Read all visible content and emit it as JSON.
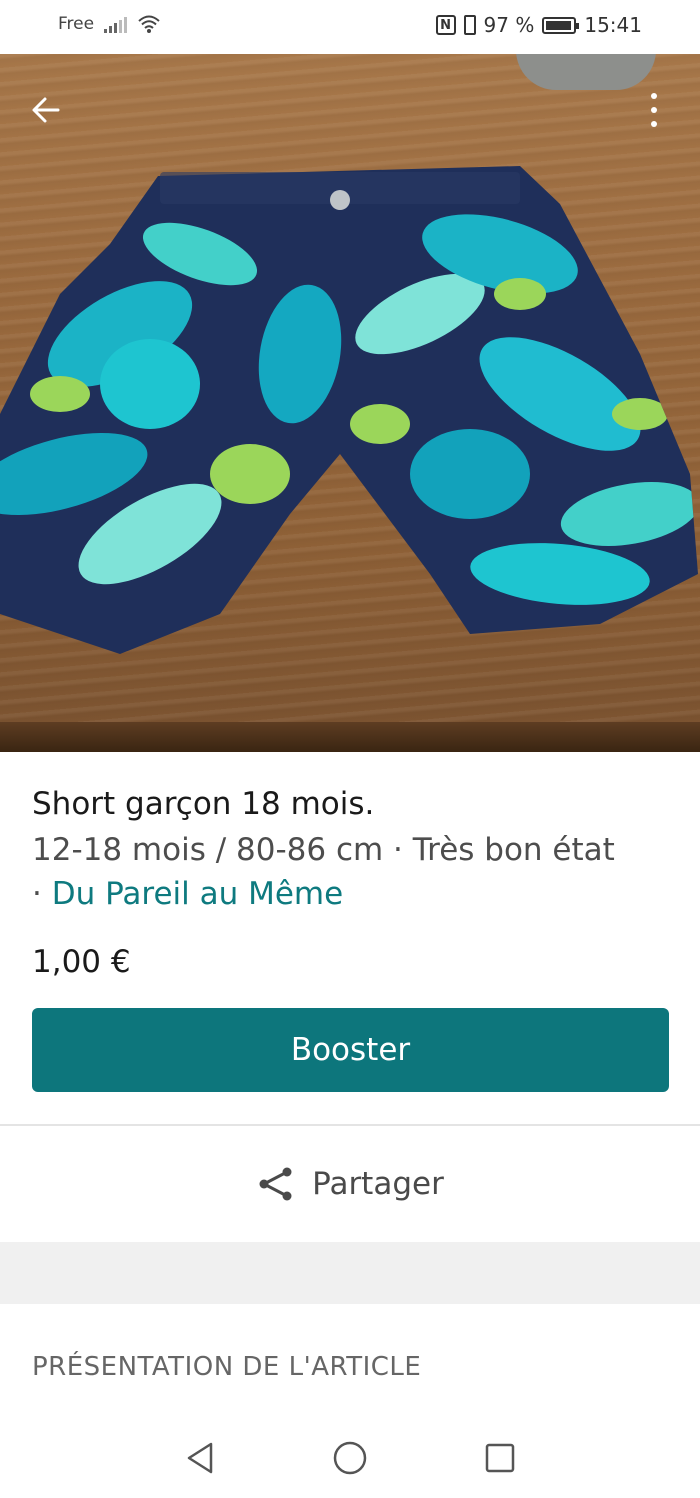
{
  "status_bar": {
    "carrier": "Free",
    "battery": "97 %",
    "time": "15:41",
    "nfc": "N"
  },
  "hero": {
    "icons": {
      "back": "arrow-left-icon",
      "more": "more-vertical-icon"
    }
  },
  "listing": {
    "title": "Short garçon 18 mois.",
    "details": "12-18 mois / 80-86 cm · Très bon état",
    "brand_separator": "·",
    "brand": "Du Pareil au Même",
    "price": "1,00 €"
  },
  "actions": {
    "booster_label": "Booster",
    "share_label": "Partager"
  },
  "section": {
    "title": "PRÉSENTATION DE L'ARTICLE"
  },
  "colors": {
    "accent": "#0d767c",
    "brand_link": "#0e7a7f"
  }
}
